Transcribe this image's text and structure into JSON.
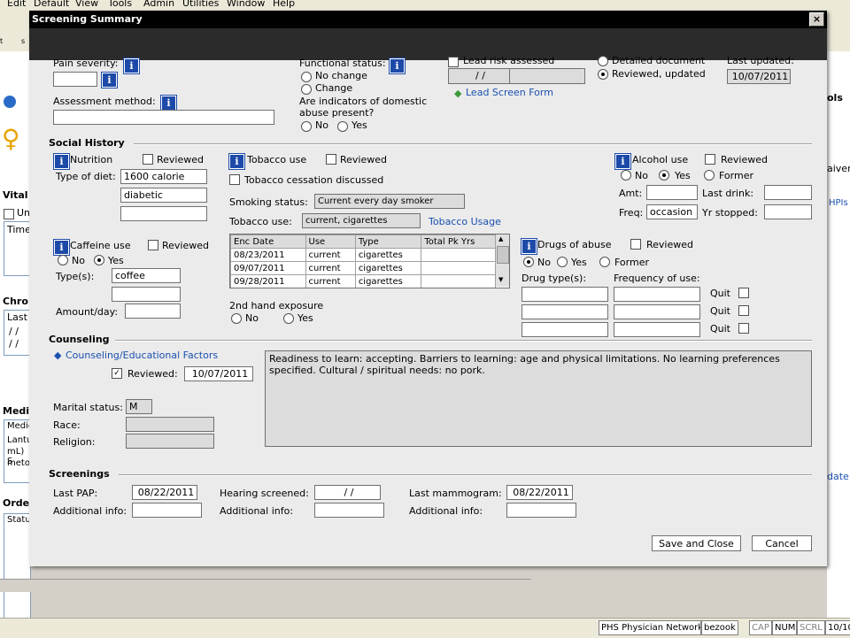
{
  "app": {
    "menu": [
      "Edit",
      "Default",
      "View",
      "Tools",
      "Admin",
      "Utilities",
      "Window",
      "Help"
    ],
    "bg_labels": {
      "vital": "Vital",
      "chro": "Chro",
      "medi": "Medi",
      "orde": "Orde",
      "time": "Time",
      "last": "Last",
      "status": "Status",
      "medic": "Medic",
      "lantu": "Lantu",
      "ml": "mL) S",
      "metor": "metor",
      "slashes": "/ /",
      "un": "Un",
      "hpis": "HPIs",
      "aiver": "aiver",
      "ols": "ols",
      "date": "date",
      "tiny_s": "s",
      "tiny_t": "t"
    },
    "status_bar": {
      "network": "PHS Physician Network",
      "user": "bezook",
      "cap": "CAP",
      "num": "NUM",
      "scrl": "SCRL",
      "date": "10/10"
    },
    "colors": {
      "info_icon": "#1d4aa8",
      "link": "#1a50b0",
      "dialog_bg": "#ebebeb"
    }
  },
  "dialog": {
    "title": "Screening Summary",
    "close_glyph": "×",
    "top": {
      "pain_severity_label": "Pain severity:",
      "pain_severity_value": "",
      "assessment_method_label": "Assessment method:",
      "assessment_method_value": "",
      "functional_status_label": "Functional status:",
      "functional_status_options": [
        "No change",
        "Change"
      ],
      "domestic_abuse_label": "Are indicators of domestic abuse present?",
      "domestic_abuse_options": [
        "No",
        "Yes"
      ],
      "lead_risk_label": "Lead risk assessed",
      "lead_risk_date": " / /",
      "lead_screen_link": "Lead Screen Form",
      "detailed_document_label": "Detailed document",
      "reviewed_updated_label": "Reviewed, updated",
      "last_updated_label": "Last updated:",
      "last_updated_value": "10/07/2011"
    },
    "social_history": {
      "title": "Social History",
      "nutrition_label": "Nutrition",
      "reviewed_label": "Reviewed",
      "type_of_diet_label": "Type of diet:",
      "diet_values": [
        "1600 calorie",
        "diabetic",
        ""
      ],
      "caffeine_label": "Caffeine use",
      "caffeine_options": [
        "No",
        "Yes"
      ],
      "types_label": "Type(s):",
      "caffeine_types": [
        "coffee",
        ""
      ],
      "amount_day_label": "Amount/day:",
      "amount_day_value": "",
      "tobacco_label": "Tobacco use",
      "tobacco_cessation_label": "Tobacco cessation discussed",
      "smoking_status_label": "Smoking status:",
      "smoking_status_value": "Current every day smoker",
      "tobacco_use_label": "Tobacco use:",
      "tobacco_use_value": "current, cigarettes",
      "tobacco_usage_link": "Tobacco Usage",
      "tobacco_table": {
        "headers": [
          "Enc Date",
          "Use",
          "Type",
          "Total Pk Yrs"
        ],
        "rows": [
          [
            "08/23/2011",
            "current",
            "cigarettes",
            ""
          ],
          [
            "09/07/2011",
            "current",
            "cigarettes",
            ""
          ],
          [
            "09/28/2011",
            "current",
            "cigarettes",
            ""
          ]
        ]
      },
      "second_hand_label": "2nd hand exposure",
      "second_hand_options": [
        "No",
        "Yes"
      ],
      "alcohol_label": "Alcohol use",
      "alcohol_options": [
        "No",
        "Yes",
        "Former"
      ],
      "amt_label": "Amt:",
      "amt_value": "",
      "last_drink_label": "Last drink:",
      "last_drink_value": "",
      "freq_label": "Freq:",
      "freq_value": "occasion",
      "yr_stopped_label": "Yr stopped:",
      "yr_stopped_value": "",
      "drugs_label": "Drugs of abuse",
      "drugs_options": [
        "No",
        "Yes",
        "Former"
      ],
      "drug_types_label": "Drug type(s):",
      "frequency_label": "Frequency of use:",
      "quit_label": "Quit"
    },
    "counseling": {
      "title": "Counseling",
      "factors_link": "Counseling/Educational Factors",
      "reviewed_label": "Reviewed:",
      "reviewed_date": "10/07/2011",
      "notes": "Readiness to learn: accepting. Barriers to learning: age and physical limitations. No learning preferences specified. Cultural / spiritual needs: no pork.",
      "marital_status_label": "Marital status:",
      "marital_status_value": "M",
      "race_label": "Race:",
      "race_value": "",
      "religion_label": "Religion:",
      "religion_value": ""
    },
    "screenings": {
      "title": "Screenings",
      "last_pap_label": "Last PAP:",
      "last_pap_value": "08/22/2011",
      "hearing_label": "Hearing screened:",
      "hearing_value": " / /",
      "mammogram_label": "Last mammogram:",
      "mammogram_value": "08/22/2011",
      "additional_info_label": "Additional info:"
    },
    "buttons": {
      "save_close": "Save and Close",
      "cancel": "Cancel"
    }
  }
}
